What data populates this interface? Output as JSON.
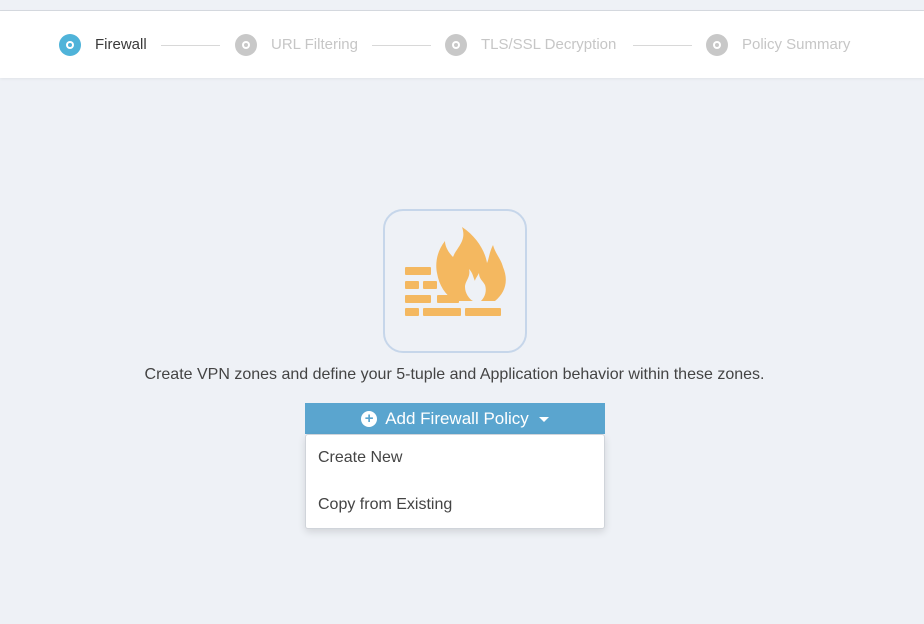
{
  "wizard": {
    "steps": [
      {
        "label": "Firewall",
        "state": "active"
      },
      {
        "label": "URL Filtering",
        "state": "inactive"
      },
      {
        "label": "TLS/SSL Decryption",
        "state": "inactive"
      },
      {
        "label": "Policy Summary",
        "state": "inactive"
      }
    ]
  },
  "main": {
    "illustration_icon": "firewall-icon",
    "description": "Create VPN zones and define your 5-tuple and Application behavior within these zones.",
    "add_button": {
      "icon": "plus-circle-icon",
      "label": "Add Firewall Policy",
      "caret": "caret-down-icon"
    },
    "dropdown": {
      "items": [
        {
          "label": "Create New"
        },
        {
          "label": "Copy from Existing"
        }
      ]
    }
  },
  "colors": {
    "active_step": "#4fb3d9",
    "inactive_step": "#c8c8c8",
    "button": "#5aa5cf",
    "firewall_icon": "#f4b860",
    "background": "#eef1f6"
  }
}
